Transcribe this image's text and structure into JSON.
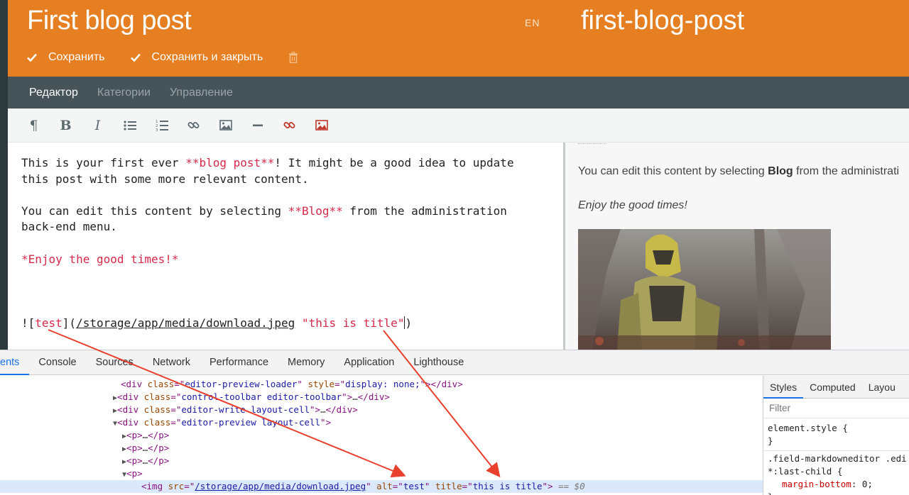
{
  "header": {
    "title": "First blog post",
    "lang": "EN",
    "slug": "first-blog-post",
    "save_label": "Сохранить",
    "save_close_label": "Сохранить и закрыть"
  },
  "tabs": [
    "Редактор",
    "Категории",
    "Управление"
  ],
  "editor": {
    "line1a": "This is your first ever ",
    "line1b": "**blog post**",
    "line1c": "! It might be a good idea to update",
    "line2": "this post with some more relevant content.",
    "line3a": "You can edit this content by selecting ",
    "line3b": "**Blog**",
    "line3c": " from the administration",
    "line4": "back-end menu.",
    "line5": "*Enjoy the good times!*",
    "img_prefix": "![",
    "img_alt": "test",
    "img_mid": "](",
    "img_url": "/storage/app/media/download.jpeg",
    "img_space": " ",
    "img_title": "\"this is title\"",
    "img_end": ")"
  },
  "preview": {
    "p1a": "You can edit this content by selecting ",
    "p1b": "Blog",
    "p1c": " from the administrati",
    "p2": "Enjoy the good times!"
  },
  "devtools": {
    "tabs": [
      "ents",
      "Console",
      "Sources",
      "Network",
      "Performance",
      "Memory",
      "Application",
      "Lighthouse"
    ],
    "side_tabs": [
      "Styles",
      "Computed",
      "Layou"
    ],
    "filter": "Filter",
    "rule1_sel": "element.style {",
    "rule1_end": "}",
    "rule2_sel": ".field-markdowneditor .edi",
    "rule2_sel2": "*:last-child {",
    "rule2_prop": "margin-bottom",
    "rule2_val": ": 0;",
    "rule2_end": "}",
    "dollar": "== $0",
    "t_div": "div",
    "t_p": "p",
    "t_img": "img",
    "a_class": "class",
    "a_style": "style",
    "a_src": "src",
    "a_alt": "alt",
    "a_title": "title",
    "v_loader": "editor-preview-loader",
    "v_none": "display: none;",
    "v_toolbar": "control-toolbar editor-toolbar",
    "v_write": "editor-write layout-cell",
    "v_preview": "editor-preview layout-cell",
    "v_src": "/storage/app/media/download.jpeg",
    "v_alt": "test",
    "v_title": "this is title",
    "ellipsis": "…"
  }
}
